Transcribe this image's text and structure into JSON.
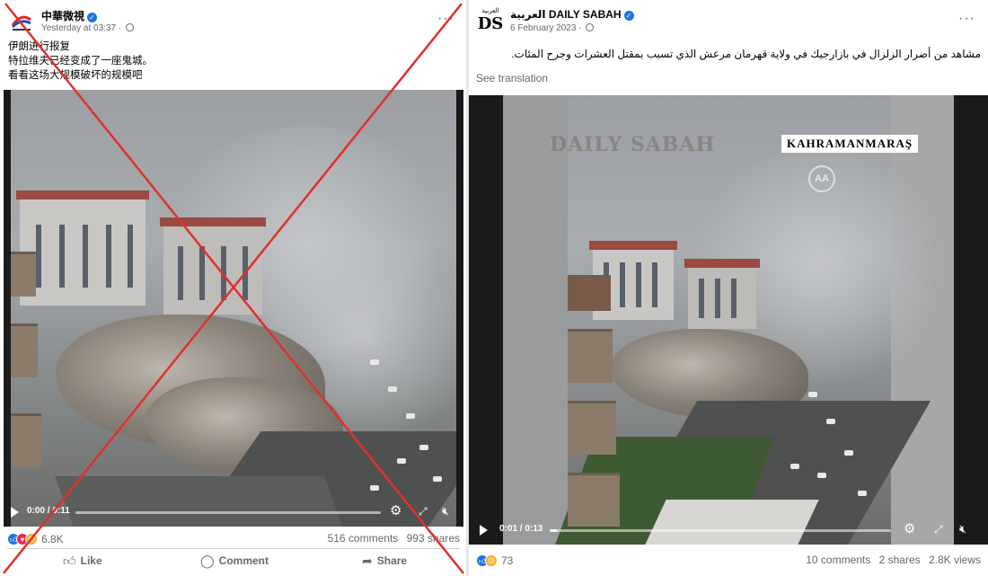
{
  "left_post": {
    "page_name": "中華微視",
    "timestamp": "Yesterday at 03:37 ·",
    "caption_lines": [
      "伊朗进行报复",
      "特拉维夫已经变成了一座鬼城。",
      "看看这场大规模破坏的规模吧"
    ],
    "video": {
      "time": "0:00 / 0:11",
      "progress_fraction": 0.0
    },
    "reactions_count": "6.8K",
    "comments": "516 comments",
    "shares": "993 shares",
    "actions": {
      "like": "Like",
      "comment": "Comment",
      "share": "Share"
    },
    "marked_false": true,
    "cross_color": "#e0312b"
  },
  "right_post": {
    "page_name": "العربية DAILY SABAH",
    "timestamp": "6 February 2023 ·",
    "avatar_text_top": "العربية",
    "avatar_text_logo": "DS",
    "caption": "مشاهد من أضرار الزلزال في بازارجيك في ولاية قهرمان مرعش الذي تسبب بمقتل العشرات وجرح المئات.",
    "see_translation": "See translation",
    "video": {
      "time": "0:01 / 0:13",
      "progress_fraction": 0.02,
      "watermark": "DAILY SABAH",
      "location_tag": "KAHRAMANMARAŞ",
      "agency_logo": "AA"
    },
    "reactions_count": "73",
    "comments": "10 comments",
    "shares": "2 shares",
    "views": "2.8K views"
  },
  "colors": {
    "facebook_blue": "#1b74e4",
    "secondary_text": "#65676b",
    "verified": "#1b74e4"
  }
}
